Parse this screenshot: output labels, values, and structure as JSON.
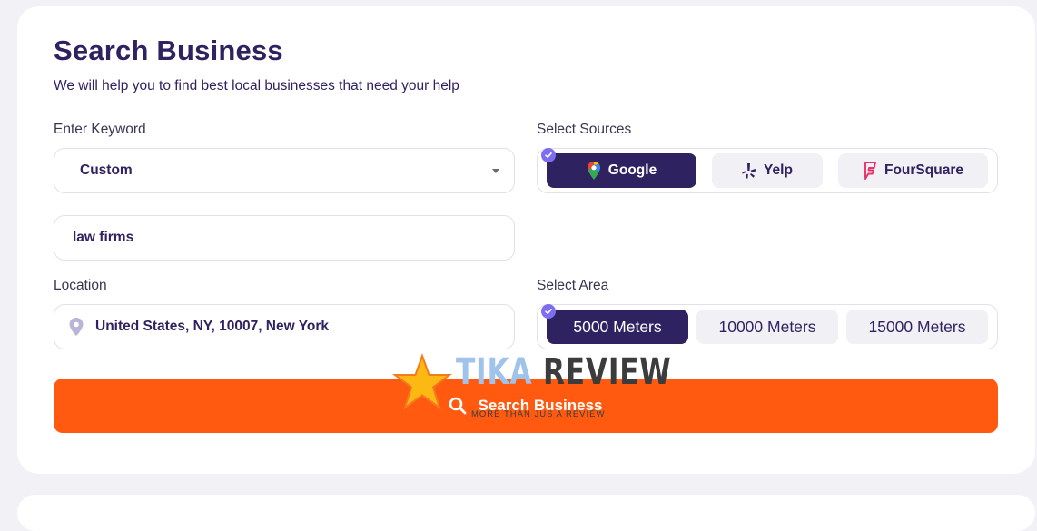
{
  "page": {
    "title": "Search Business",
    "subtitle": "We will help you to find best local businesses that need your help"
  },
  "keyword": {
    "label": "Enter Keyword",
    "selected": "Custom",
    "value": "law firms"
  },
  "location": {
    "label": "Location",
    "value": "United States, NY, 10007, New York"
  },
  "sources": {
    "label": "Select Sources",
    "options": [
      "Google",
      "Yelp",
      "FourSquare"
    ],
    "selected": "Google"
  },
  "area": {
    "label": "Select Area",
    "options": [
      "5000 Meters",
      "10000 Meters",
      "15000 Meters"
    ],
    "selected": "5000 Meters"
  },
  "search_button": {
    "label": "Search Business"
  },
  "watermark": {
    "word1": "TIKA",
    "word2": "REVIEW",
    "tagline": "MORE THAN JUS A REVIEW"
  },
  "colors": {
    "primary": "#2f2260",
    "accent": "#ff5a10",
    "check": "#7d6df0"
  }
}
